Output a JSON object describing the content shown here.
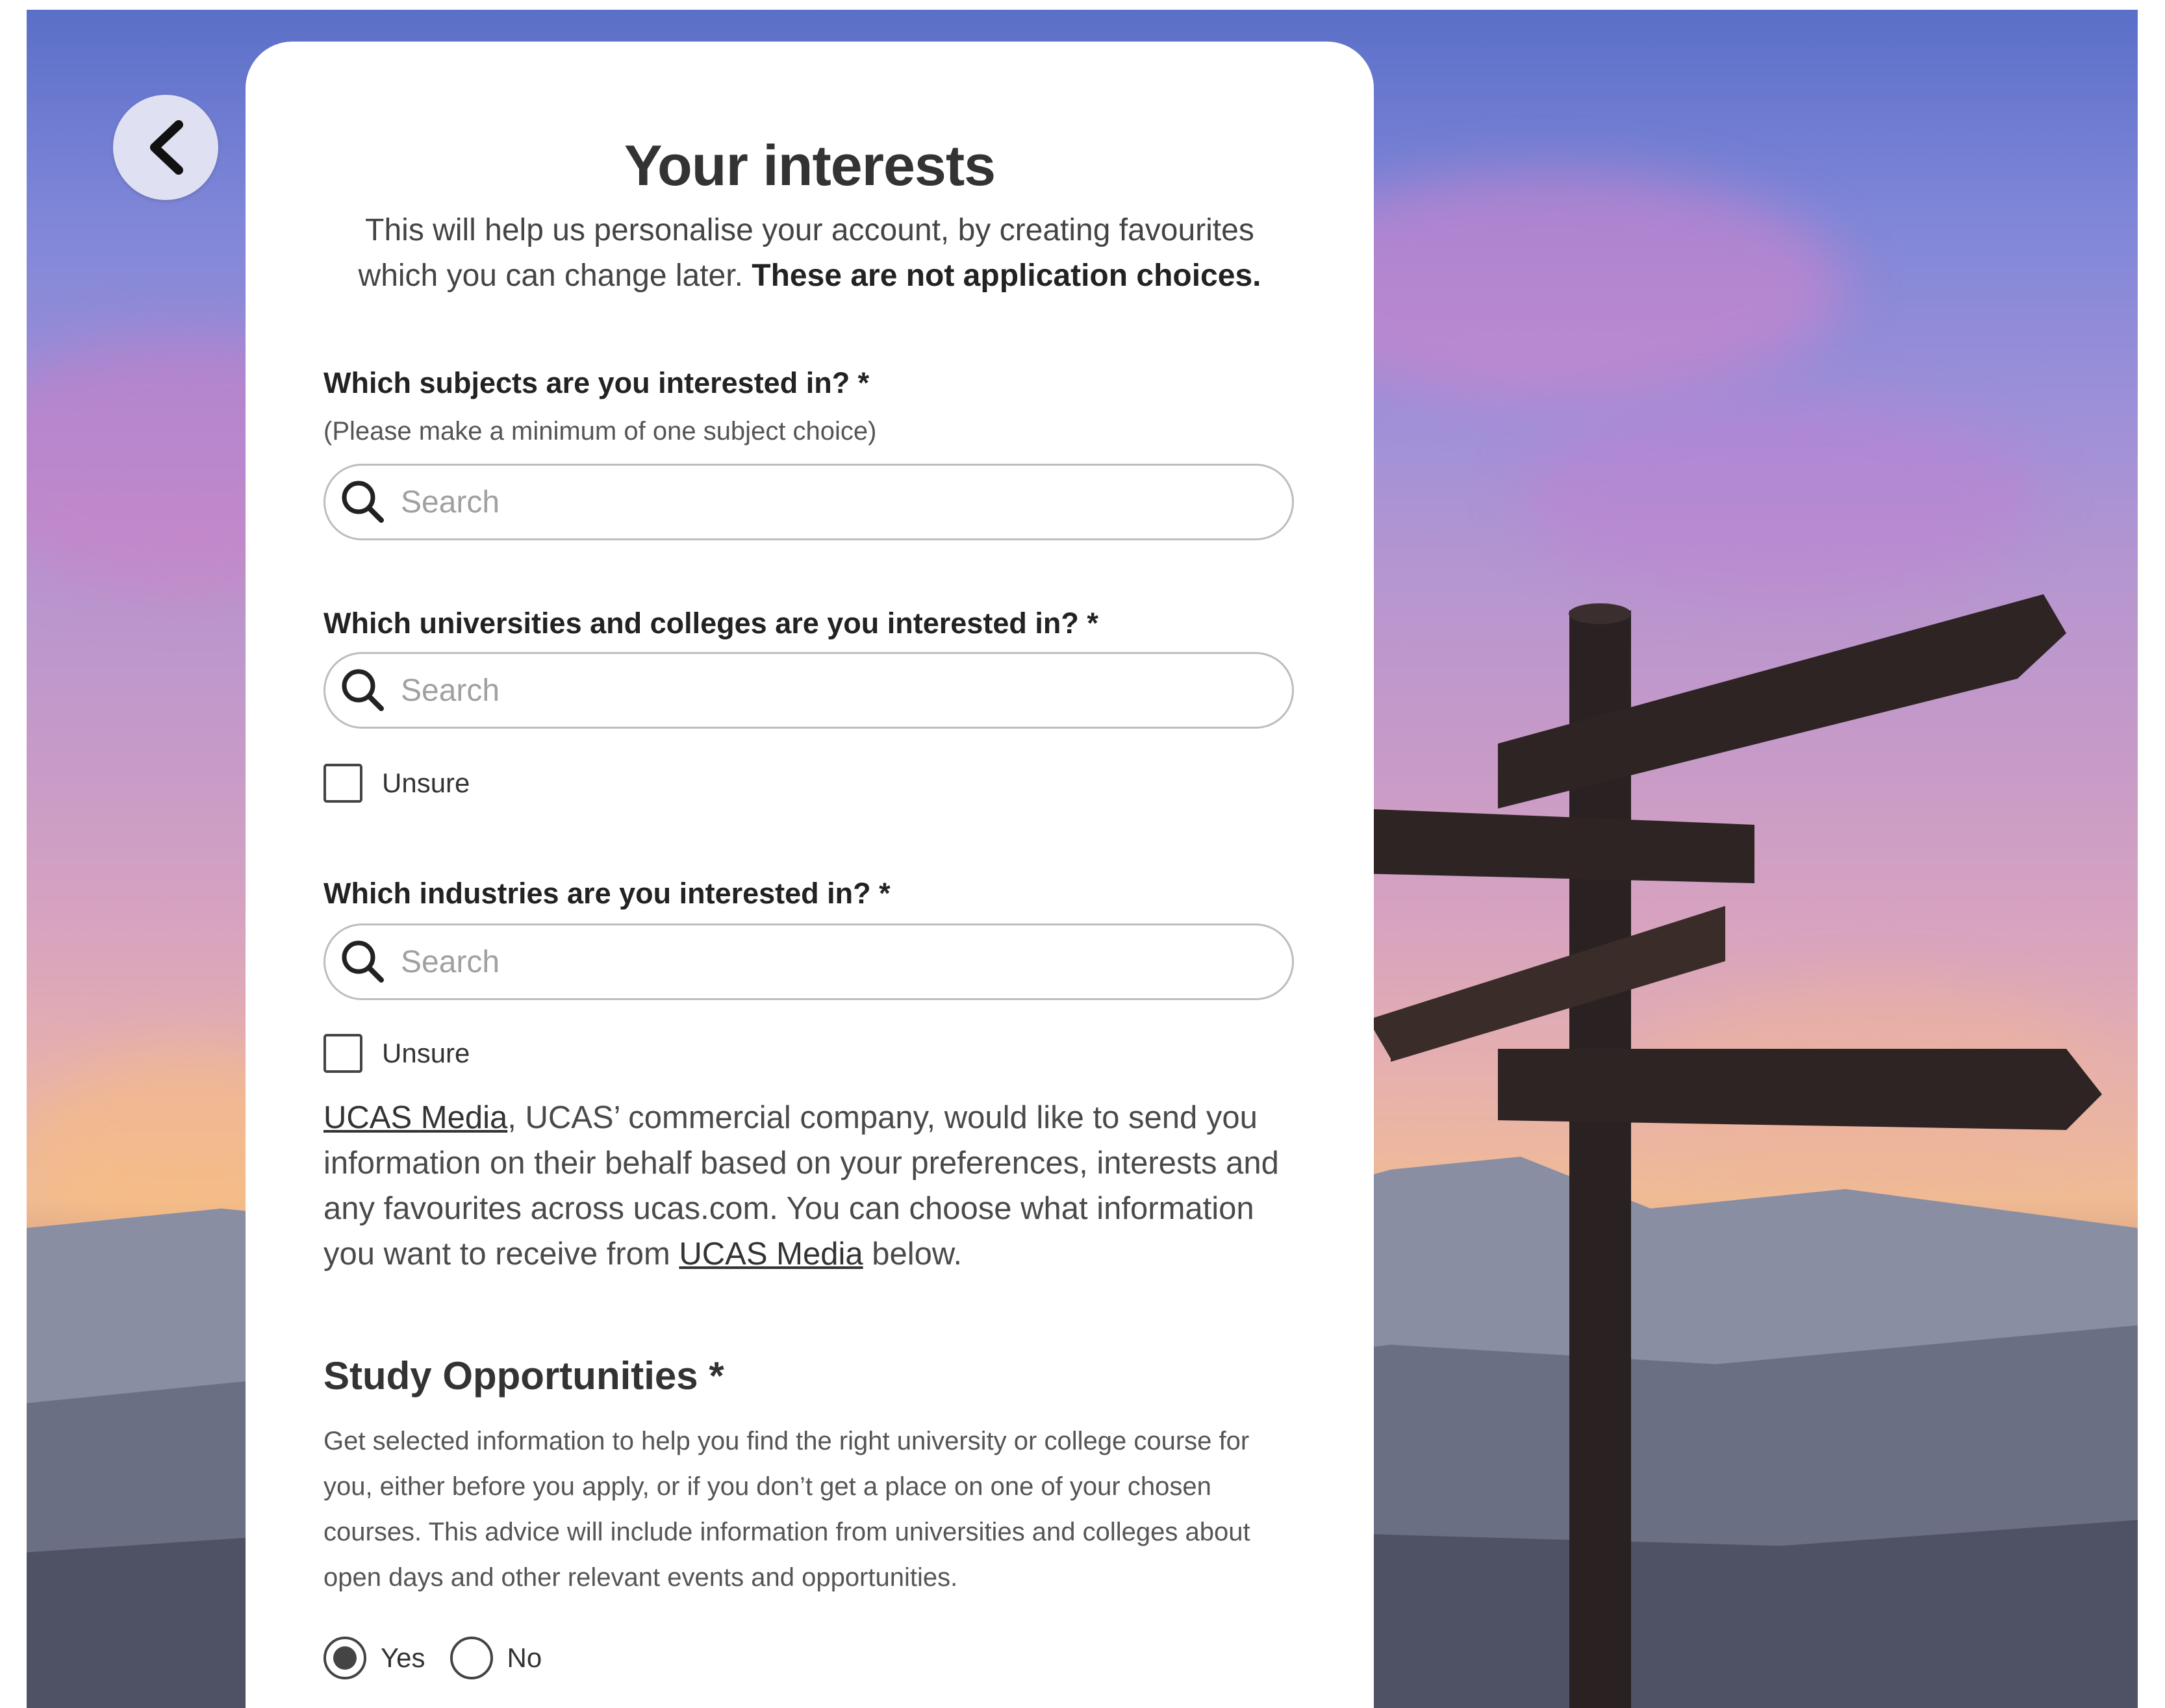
{
  "page": {
    "title": "Your interests",
    "intro_text": "This will help us personalise your account, by creating favourites which you can change later. ",
    "intro_bold": "These are not application choices."
  },
  "subjects": {
    "label": "Which subjects are you interested in? *",
    "hint": "(Please make a minimum of one subject choice)",
    "placeholder": "Search"
  },
  "universities": {
    "label": "Which universities and colleges are you interested in? *",
    "placeholder": "Search",
    "unsure_label": "Unsure"
  },
  "industries": {
    "label": "Which industries are you interested in? *",
    "placeholder": "Search",
    "unsure_label": "Unsure"
  },
  "media": {
    "link1": "UCAS Media",
    "text1": ", UCAS’ commercial company, would like to send you information on their behalf based on your preferences, interests and any favourites across ucas.com. You can choose what information you want to receive from ",
    "link2": "UCAS Media",
    "text2": " below."
  },
  "study": {
    "heading": "Study Opportunities *",
    "description": "Get selected information to help you find the right university or college course for you, either before you apply, or if you don’t get a place on one of your chosen courses. This advice will include information from universities and colleges about open days and other relevant events and opportunities.",
    "yes_label": "Yes",
    "no_label": "No",
    "selected": "Yes"
  },
  "icons": {
    "back": "chevron-left-icon",
    "search": "search-icon"
  }
}
